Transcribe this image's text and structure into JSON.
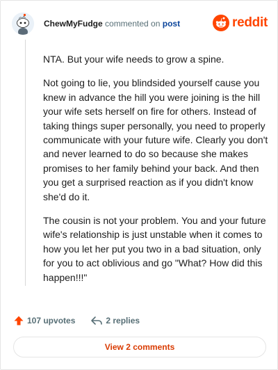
{
  "header": {
    "username": "ChewMyFudge",
    "action_text": "commented on",
    "post_link": "post",
    "brand": "reddit"
  },
  "comment": {
    "paragraphs": [
      "NTA. But your wife needs to grow a spine.",
      "Not going to lie, you blindsided yourself cause you knew in advance the hill you were joining is the hill your wife sets herself on fire for others. Instead of taking things super personally, you need to properly communicate with your future wife. Clearly you don't and never learned to do so because she makes promises to her family behind your back. And then you get a surprised reaction as if you didn't know she'd do it.",
      "The cousin is not your problem. You and your future wife's relationship is just unstable when it comes to how you let her put you two in a bad situation, only for you to act oblivious and go \"What? How did this happen!!!\""
    ]
  },
  "actions": {
    "upvotes": "107 upvotes",
    "replies": "2 replies"
  },
  "view_comments": "View 2 comments",
  "colors": {
    "brand": "#ff4500",
    "link": "#0a449b",
    "cta": "#d93a00"
  },
  "icons": {
    "avatar": "snoo-avatar",
    "logo": "reddit-logo-icon",
    "upvote": "upvote-arrow-icon",
    "reply": "reply-arrow-icon"
  }
}
